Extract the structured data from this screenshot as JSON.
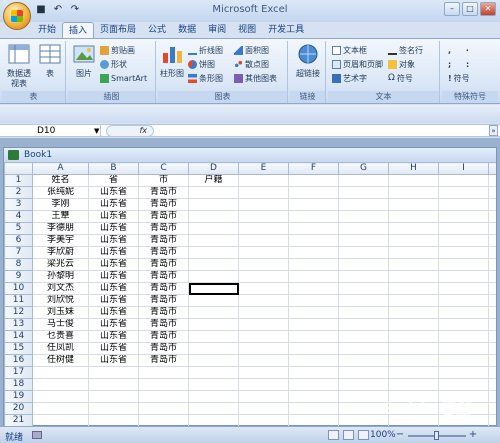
{
  "app": {
    "title": "Microsoft Excel"
  },
  "tabs": [
    "开始",
    "插入",
    "页面布局",
    "公式",
    "数据",
    "审阅",
    "视图",
    "开发工具"
  ],
  "active_tab": 1,
  "ribbon": {
    "table_group": {
      "label": "表",
      "pivot": "数据透视表",
      "table": "表"
    },
    "illus_group": {
      "label": "插图",
      "picture": "图片",
      "clipart": "剪贴画",
      "shapes": "形状",
      "smartart": "SmartArt"
    },
    "chart_group": {
      "label": "图表",
      "column": "柱形图",
      "line": "折线图",
      "pie": "饼图",
      "bar": "条形图",
      "area": "面积图",
      "scatter": "散点图",
      "other": "其他图表"
    },
    "link_group": {
      "label": "链接",
      "hyperlink": "超链接"
    },
    "text_group": {
      "label": "文本",
      "textbox": "文本框",
      "header_footer": "页眉和页脚",
      "wordart": "艺术字",
      "signature": "签名行",
      "object": "对象",
      "symbol": "符号"
    },
    "special_group": {
      "label": "特殊符号",
      "symbol": "符号"
    }
  },
  "formula_bar": {
    "name_box": "D10",
    "fx": "fx"
  },
  "workbook": {
    "title": "Book1"
  },
  "sheet": {
    "columns": [
      "A",
      "B",
      "C",
      "D",
      "E",
      "F",
      "G",
      "H",
      "I",
      "J"
    ],
    "rows": [
      [
        "姓名",
        "省",
        "市",
        "户籍"
      ],
      [
        "张纯妮",
        "山东省",
        "青岛市",
        ""
      ],
      [
        "李刚",
        "山东省",
        "青岛市",
        ""
      ],
      [
        "王犨",
        "山东省",
        "青岛市",
        ""
      ],
      [
        "李德朋",
        "山东省",
        "青岛市",
        ""
      ],
      [
        "李美宇",
        "山东省",
        "青岛市",
        ""
      ],
      [
        "李欣蔚",
        "山东省",
        "青岛市",
        ""
      ],
      [
        "梁兆云",
        "山东省",
        "青岛市",
        ""
      ],
      [
        "孙黎明",
        "山东省",
        "青岛市",
        ""
      ],
      [
        "刘文杰",
        "山东省",
        "青岛市",
        ""
      ],
      [
        "刘欣悦",
        "山东省",
        "青岛市",
        ""
      ],
      [
        "刘玉妹",
        "山东省",
        "青岛市",
        ""
      ],
      [
        "马士俊",
        "山东省",
        "青岛市",
        ""
      ],
      [
        "乜贵喜",
        "山东省",
        "青岛市",
        ""
      ],
      [
        "任凤凯",
        "山东省",
        "青岛市",
        ""
      ],
      [
        "任树健",
        "山东省",
        "青岛市",
        ""
      ],
      [
        "",
        "",
        "",
        ""
      ],
      [
        "",
        "",
        "",
        ""
      ],
      [
        "",
        "",
        "",
        ""
      ],
      [
        "",
        "",
        "",
        ""
      ],
      [
        "",
        "",
        "",
        ""
      ],
      [
        "",
        "",
        "",
        ""
      ]
    ]
  },
  "status": {
    "ready": "就绪",
    "zoom": "100%"
  },
  "watermark": "Baidu经验",
  "colors": {
    "ribbon_bg": "#dbe7f6",
    "accent": "#15428b"
  }
}
